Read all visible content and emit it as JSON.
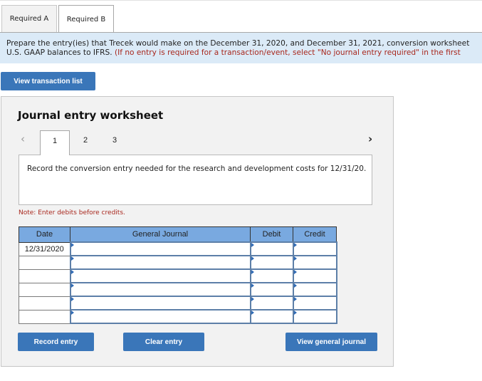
{
  "tabs": [
    {
      "label": "Required A",
      "active": false
    },
    {
      "label": "Required B",
      "active": true
    }
  ],
  "instructions": {
    "main": "Prepare the entry(ies) that Trecek would make on the December 31, 2020, and December 31, 2021, conversion worksheet",
    "line2": "U.S. GAAP balances to IFRS. ",
    "red": "(If no entry is required for a transaction/event, select \"No journal entry required\" in the first"
  },
  "view_transaction_list_label": "View transaction list",
  "worksheet": {
    "title": "Journal entry worksheet",
    "prev_icon": "‹",
    "next_icon": "›",
    "steps": [
      "1",
      "2",
      "3"
    ],
    "active_step": "1",
    "description": "Record the conversion entry needed for the research and development costs for 12/31/20.",
    "note": "Note: Enter debits before credits.",
    "table": {
      "headers": [
        "Date",
        "General Journal",
        "Debit",
        "Credit"
      ],
      "rows": [
        {
          "date": "12/31/2020",
          "account": "",
          "debit": "",
          "credit": ""
        },
        {
          "date": "",
          "account": "",
          "debit": "",
          "credit": ""
        },
        {
          "date": "",
          "account": "",
          "debit": "",
          "credit": ""
        },
        {
          "date": "",
          "account": "",
          "debit": "",
          "credit": ""
        },
        {
          "date": "",
          "account": "",
          "debit": "",
          "credit": ""
        },
        {
          "date": "",
          "account": "",
          "debit": "",
          "credit": ""
        }
      ]
    },
    "buttons": {
      "record": "Record entry",
      "clear": "Clear entry",
      "view_journal": "View general journal"
    }
  },
  "colors": {
    "button_blue": "#3a76b9",
    "header_blue": "#79a9e0",
    "instruction_bg": "#dbeaf7",
    "note_red": "#a8271d"
  }
}
